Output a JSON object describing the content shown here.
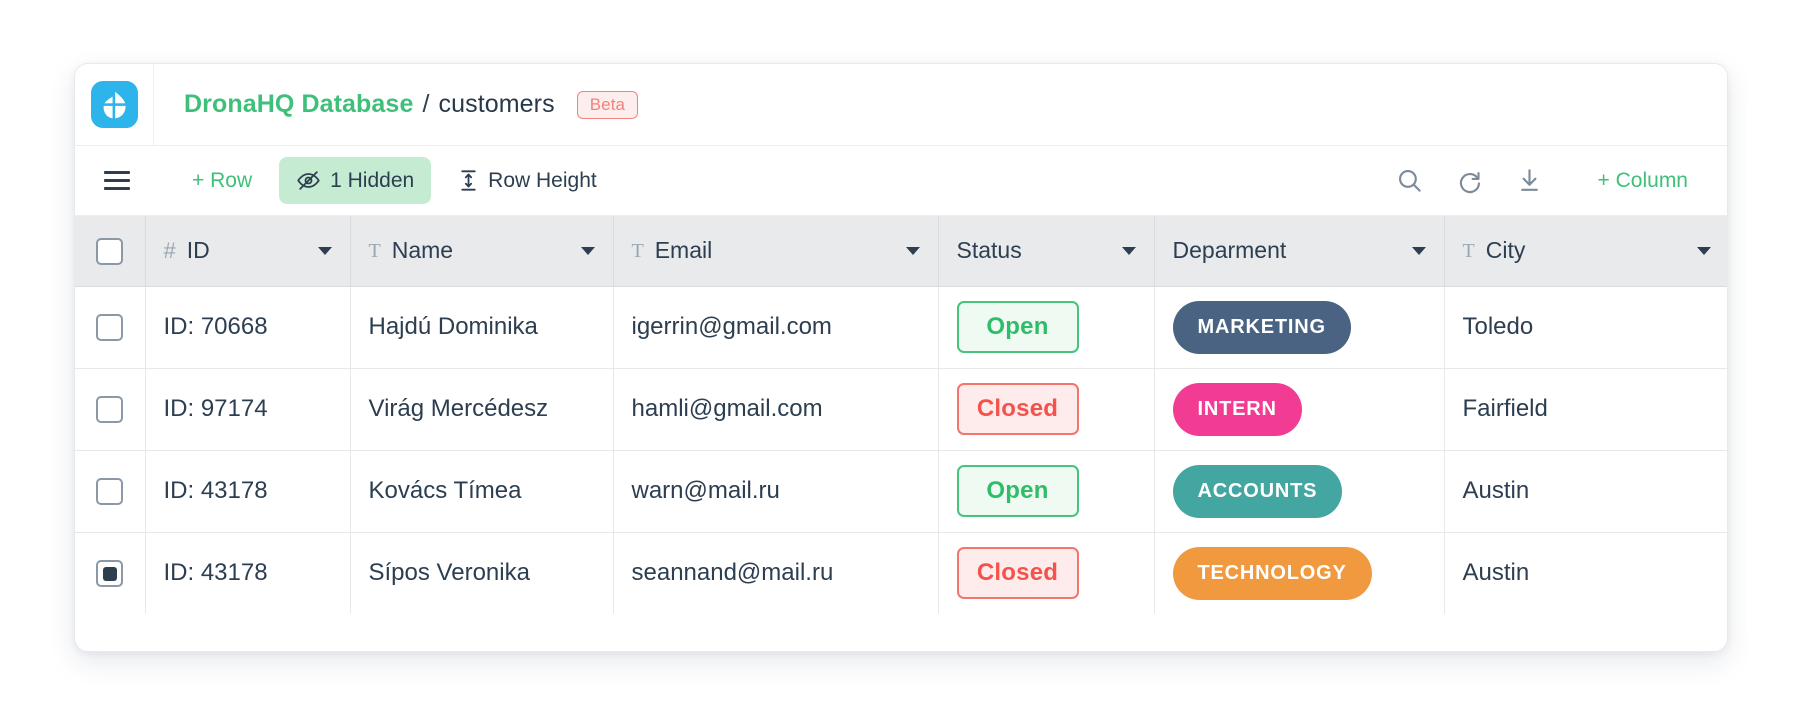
{
  "header": {
    "logo_icon": "dronahq-logo-icon",
    "breadcrumb_db": "DronaHQ Database",
    "breadcrumb_separator": "/",
    "breadcrumb_table": "customers",
    "badge": "Beta"
  },
  "toolbar": {
    "menu_icon": "hamburger-menu-icon",
    "add_row_label": "+ Row",
    "hidden_label": "1 Hidden",
    "hidden_icon": "eye-slash-icon",
    "row_height_label": "Row Height",
    "row_height_icon": "row-height-icon",
    "search_icon": "search-icon",
    "refresh_icon": "refresh-icon",
    "download_icon": "download-icon",
    "add_column_label": "+ Column"
  },
  "table": {
    "select_all_checked": false,
    "columns": [
      {
        "label": "ID",
        "type_icon": "number-type-icon",
        "type_glyph": "#",
        "has_caret": true
      },
      {
        "label": "Name",
        "type_icon": "text-type-icon",
        "type_glyph": "T",
        "has_caret": true
      },
      {
        "label": "Email",
        "type_icon": "text-type-icon",
        "type_glyph": "T",
        "has_caret": true
      },
      {
        "label": "Status",
        "type_icon": "",
        "type_glyph": "",
        "has_caret": true
      },
      {
        "label": "Deparment",
        "type_icon": "",
        "type_glyph": "",
        "has_caret": true
      },
      {
        "label": "City",
        "type_icon": "text-type-icon",
        "type_glyph": "T",
        "has_caret": true
      }
    ],
    "rows": [
      {
        "selected": false,
        "id": "ID: 70668",
        "name": "Hajdú Dominika",
        "email": "igerrin@gmail.com",
        "status": "Open",
        "status_kind": "open",
        "department": "MARKETING",
        "department_color": "#4a6382",
        "city": "Toledo"
      },
      {
        "selected": false,
        "id": "ID: 97174",
        "name": "Virág Mercédesz",
        "email": "hamli@gmail.com",
        "status": "Closed",
        "status_kind": "closed",
        "department": "INTERN",
        "department_color": "#f23c93",
        "city": "Fairfield"
      },
      {
        "selected": false,
        "id": "ID: 43178",
        "name": "Kovács Tímea",
        "email": "warn@mail.ru",
        "status": "Open",
        "status_kind": "open",
        "department": "ACCOUNTS",
        "department_color": "#44a6a0",
        "city": "Austin"
      },
      {
        "selected": true,
        "id": "ID: 43178",
        "name": "Sípos Veronika",
        "email": "seannand@mail.ru",
        "status": "Closed",
        "status_kind": "closed",
        "department": "TECHNOLOGY",
        "department_color": "#f0993f",
        "city": "Austin"
      }
    ]
  },
  "colors": {
    "brand_green": "#3fc07a",
    "logo_blue": "#2cb4eb",
    "beta_red": "#f2837c",
    "header_bg": "#e9eaec",
    "text": "#2c3e50"
  }
}
